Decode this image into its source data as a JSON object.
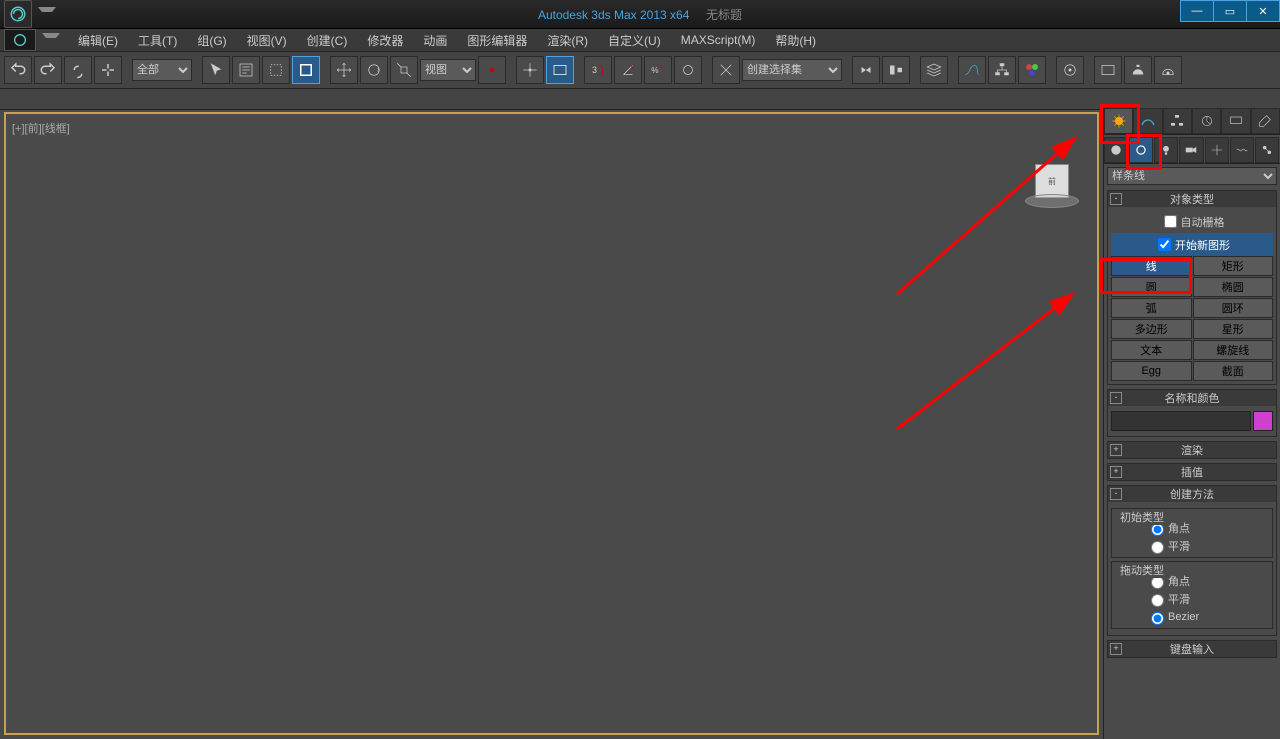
{
  "title": {
    "app": "Autodesk 3ds Max  2013 x64",
    "doc": "无标题"
  },
  "win_controls": {
    "min": "—",
    "max": "▭",
    "close": "✕"
  },
  "menu": [
    "编辑(E)",
    "工具(T)",
    "组(G)",
    "视图(V)",
    "创建(C)",
    "修改器",
    "动画",
    "图形编辑器",
    "渲染(R)",
    "自定义(U)",
    "MAXScript(M)",
    "帮助(H)"
  ],
  "toolbar": {
    "sel_filter": "全部",
    "ref_coord": "视图",
    "named_sel": "创建选择集"
  },
  "viewport": {
    "label": "[+][前][线框]"
  },
  "cmd": {
    "cat_select": "样条线",
    "rollouts": {
      "object_type": {
        "title": "对象类型",
        "autogrid": "自动栅格",
        "start_new": "开始新图形",
        "buttons": [
          [
            "线",
            "矩形"
          ],
          [
            "圆",
            "椭圆"
          ],
          [
            "弧",
            "圆环"
          ],
          [
            "多边形",
            "星形"
          ],
          [
            "文本",
            "螺旋线"
          ],
          [
            "Egg",
            "截面"
          ]
        ]
      },
      "name_color": {
        "title": "名称和颜色"
      },
      "render": {
        "title": "渲染"
      },
      "interp": {
        "title": "插值"
      },
      "method": {
        "title": "创建方法",
        "initial": {
          "legend": "初始类型",
          "opts": [
            "角点",
            "平滑"
          ]
        },
        "drag": {
          "legend": "拖动类型",
          "opts": [
            "角点",
            "平滑",
            "Bezier"
          ]
        }
      },
      "keyboard": {
        "title": "键盘输入"
      }
    }
  },
  "viewcube": {
    "face": "前"
  }
}
